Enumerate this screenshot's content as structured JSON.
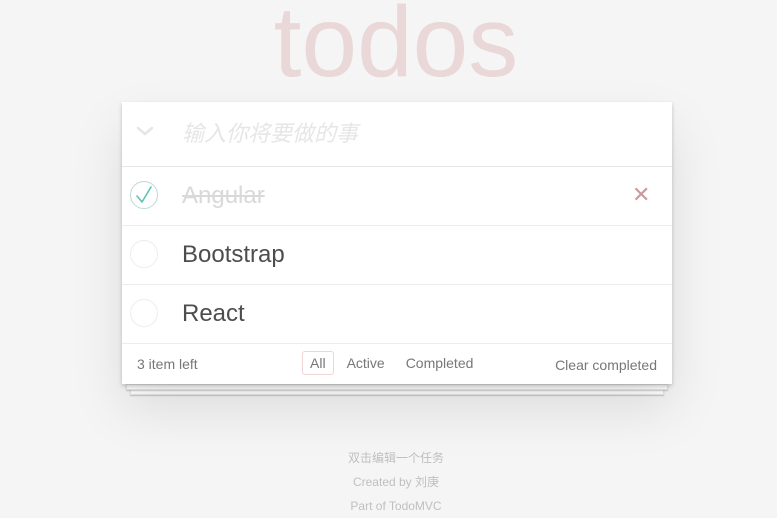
{
  "header": {
    "title": "todos",
    "new_todo_placeholder": "输入你将要做的事"
  },
  "todos": [
    {
      "label": "Angular",
      "completed": true
    },
    {
      "label": "Bootstrap",
      "completed": false
    },
    {
      "label": "React",
      "completed": false
    }
  ],
  "footer": {
    "count_text": "3 item left",
    "filters": [
      "All",
      "Active",
      "Completed"
    ],
    "selected_filter": "All",
    "clear_completed_label": "Clear completed"
  },
  "info": {
    "line1": "双击编辑一个任务",
    "line2": "Created by 刘庚",
    "line3": "Part of TodoMVC"
  },
  "colors": {
    "title": "#efd5d5",
    "checkmark": "#5dc2af",
    "destroy": "#cc9a9a",
    "background": "#f5f5f5"
  }
}
